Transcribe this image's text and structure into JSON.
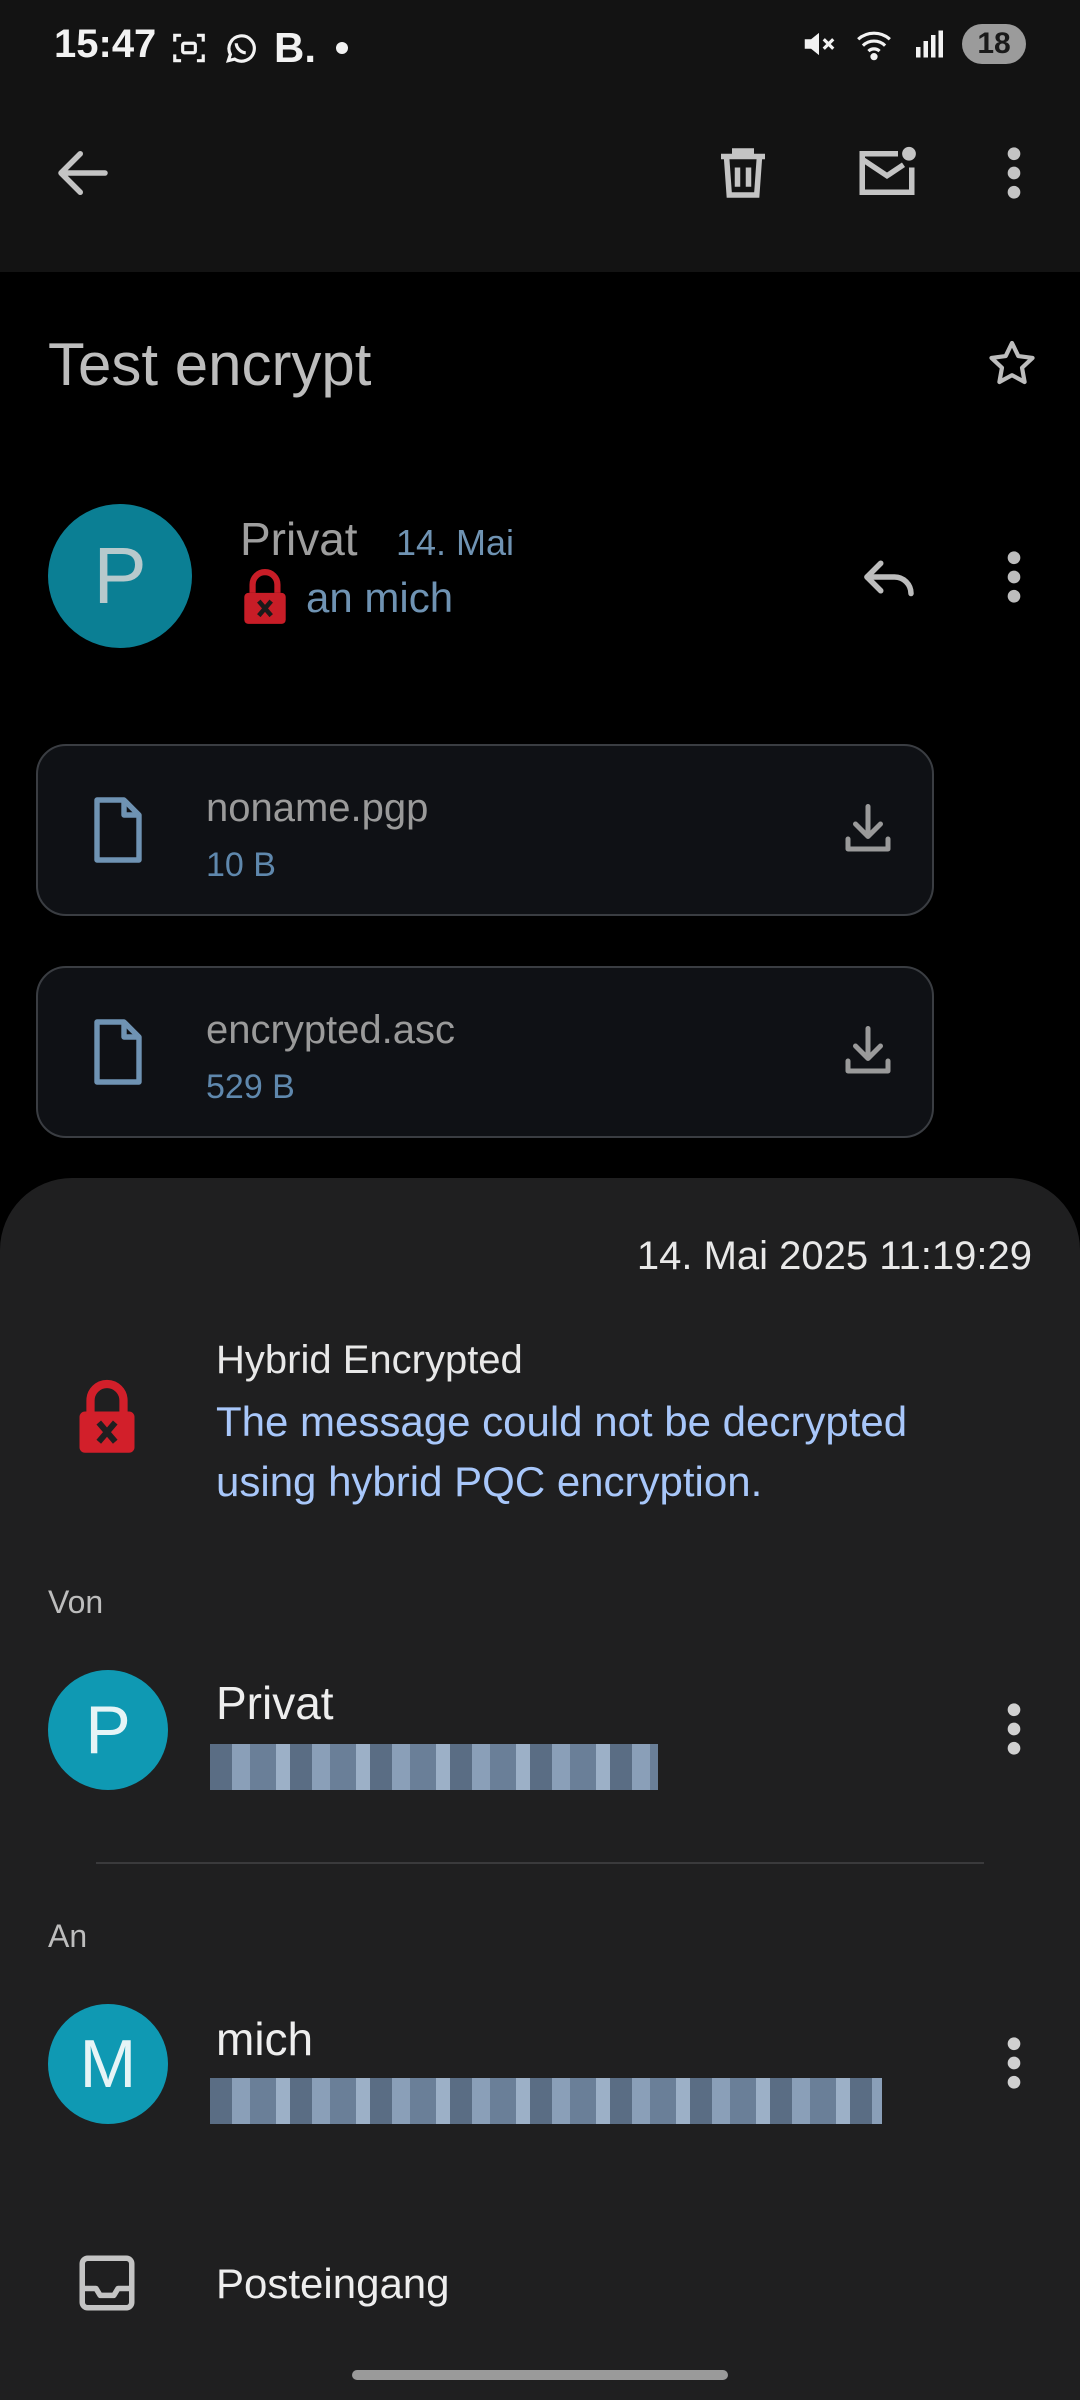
{
  "status_bar": {
    "time": "15:47",
    "app_letter": "B.",
    "battery": "18",
    "icons": [
      "screenshot-icon",
      "whatsapp-icon",
      "mute-icon",
      "wifi-icon",
      "signal-icon"
    ]
  },
  "toolbar": {
    "icons": [
      "back-arrow-icon",
      "trash-icon",
      "mark-unread-icon",
      "more-vert-icon"
    ]
  },
  "message": {
    "subject": "Test encrypt",
    "sender_initial": "P",
    "sender_name": "Privat",
    "date": "14. Mai",
    "recipient": "an mich"
  },
  "attachments": [
    {
      "name": "noname.pgp",
      "size": "10 B"
    },
    {
      "name": "encrypted.asc",
      "size": "529 B"
    }
  ],
  "details": {
    "timestamp": "14. Mai 2025 11:19:29",
    "encryption_title": "Hybrid Encrypted",
    "encryption_desc": "The message could not be decrypted using hybrid PQC encryption.",
    "from_label": "Von",
    "from": {
      "initial": "P",
      "name": "Privat"
    },
    "to_label": "An",
    "to": {
      "initial": "M",
      "name": "mich"
    },
    "folder": "Posteingang"
  },
  "colors": {
    "accent_blue": "#a8c7fa",
    "avatar_teal": "#0f99b3",
    "lock_red": "#d21f2a"
  }
}
